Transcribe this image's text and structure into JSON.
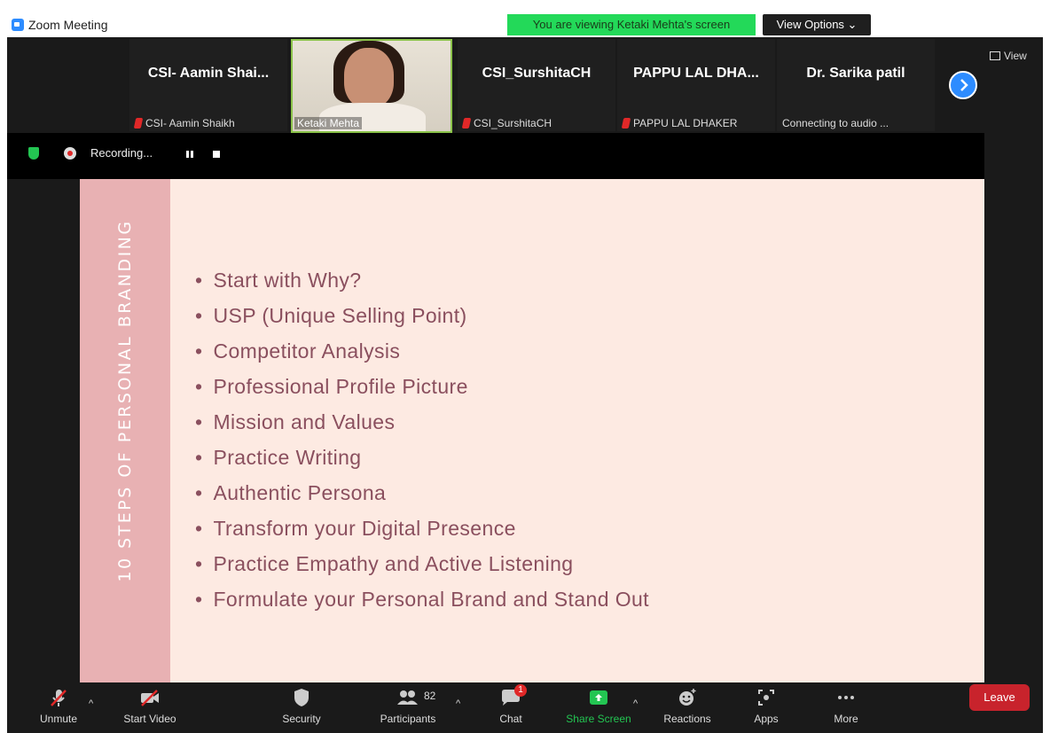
{
  "window": {
    "title": "Zoom Meeting"
  },
  "banner": {
    "viewing": "You are viewing Ketaki Mehta's screen",
    "view_options": "View Options ⌄"
  },
  "participants": [
    {
      "name": "CSI- Aamin Shai...",
      "sub": "CSI- Aamin Shaikh",
      "muted": true
    },
    {
      "name": "",
      "sub": "Ketaki Mehta",
      "muted": false,
      "video": true
    },
    {
      "name": "CSI_SurshitaCH",
      "sub": "CSI_SurshitaCH",
      "muted": true
    },
    {
      "name": "PAPPU LAL DHA...",
      "sub": "PAPPU LAL DHAKER",
      "muted": true
    },
    {
      "name": "Dr. Sarika patil",
      "sub": "Connecting to audio ...",
      "muted": false
    }
  ],
  "view_button": "View",
  "recording": {
    "label": "Recording..."
  },
  "slide": {
    "vertical_title": "10 STEPS OF PERSONAL BRANDING",
    "bullets": [
      "Start with Why?",
      "USP (Unique Selling Point)",
      "Competitor Analysis",
      "Professional Profile Picture",
      "Mission and Values",
      "Practice Writing",
      "Authentic Persona",
      "Transform your Digital Presence",
      "Practice Empathy and Active Listening",
      "Formulate your Personal Brand and Stand Out"
    ]
  },
  "toolbar": {
    "unmute": "Unmute",
    "start_video": "Start Video",
    "security": "Security",
    "participants": "Participants",
    "participants_count": "82",
    "chat": "Chat",
    "chat_badge": "1",
    "share_screen": "Share Screen",
    "reactions": "Reactions",
    "apps": "Apps",
    "more": "More",
    "leave": "Leave"
  },
  "colors": {
    "share_green": "#23c552",
    "leave_red": "#c8232c",
    "slide_bg": "#fdeae2",
    "slide_band": "#e8b1b3",
    "slide_text": "#8a4f5e",
    "banner_green": "#23d959"
  }
}
